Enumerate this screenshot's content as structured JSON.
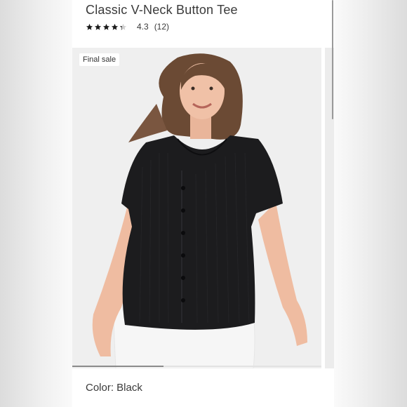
{
  "product": {
    "title": "Classic V-Neck Button Tee",
    "rating_value": "4.3",
    "review_count": "(12)",
    "stars": 4.3
  },
  "badge": {
    "label": "Final sale"
  },
  "color": {
    "label": "Color: Black"
  },
  "photo": {
    "description_icon": "product-photo-woman-black-tee"
  },
  "colors": {
    "tee": "#1c1c1e",
    "pants": "#f4f4f4",
    "bg": "#efefef"
  }
}
